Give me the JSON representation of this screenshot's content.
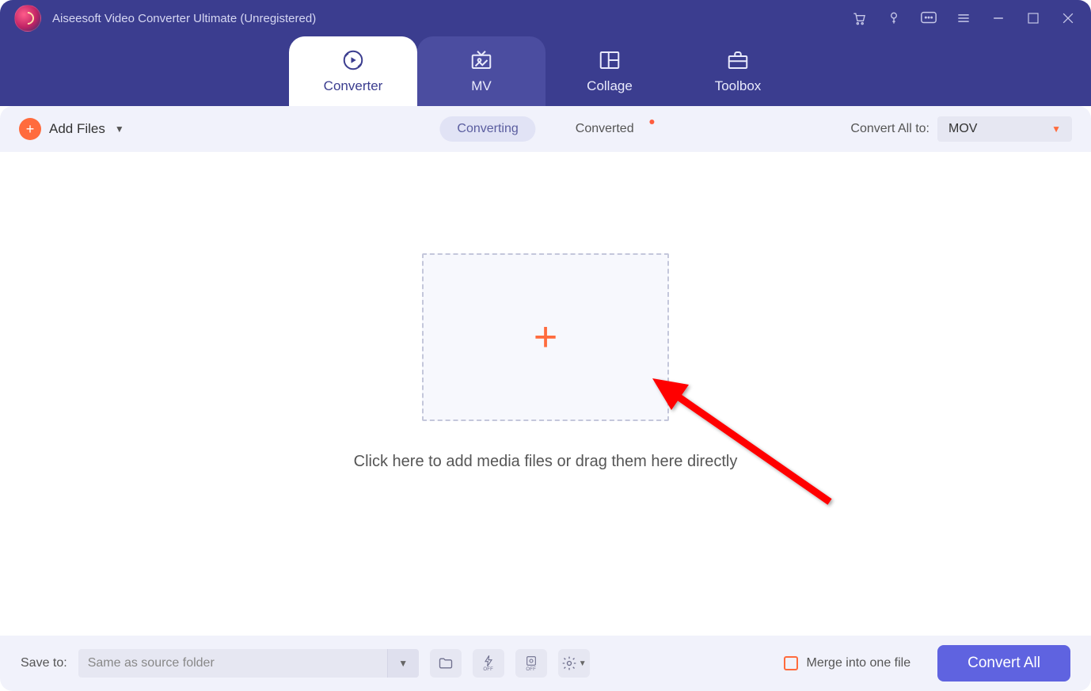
{
  "title": "Aiseesoft Video Converter Ultimate (Unregistered)",
  "tabs": {
    "converter": "Converter",
    "mv": "MV",
    "collage": "Collage",
    "toolbox": "Toolbox"
  },
  "toolbar": {
    "add_files": "Add Files",
    "converting": "Converting",
    "converted": "Converted",
    "convert_all_to": "Convert All to:",
    "format": "MOV"
  },
  "dropzone": {
    "hint": "Click here to add media files or drag them here directly"
  },
  "footer": {
    "save_to_label": "Save to:",
    "save_to_value": "Same as source folder",
    "merge_label": "Merge into one file",
    "convert_button": "Convert All"
  }
}
